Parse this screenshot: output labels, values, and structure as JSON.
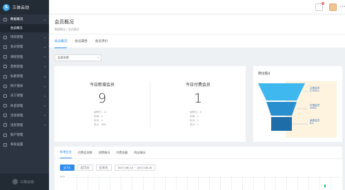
{
  "app": {
    "name": "三体云动",
    "logo_glyph": "S",
    "footer_brand": "三体云动"
  },
  "sidebar": {
    "items": [
      {
        "label": "数据概况",
        "active": true,
        "expanded": true
      },
      {
        "label": "场馆管理"
      },
      {
        "label": "会员管理"
      },
      {
        "label": "课程管理"
      },
      {
        "label": "营销管理"
      },
      {
        "label": "私教管理"
      },
      {
        "label": "统计报表"
      },
      {
        "label": "员工管理"
      },
      {
        "label": "商品管理"
      },
      {
        "label": "活动管理"
      },
      {
        "label": "消息管理"
      },
      {
        "label": "账户管理"
      },
      {
        "label": "系统设置"
      }
    ],
    "sub_items": [
      {
        "label": "会员概况"
      }
    ]
  },
  "topbar": {
    "notification_count": "1"
  },
  "header": {
    "title": "会员概况",
    "breadcrumb": "数据概况 / 会员概况"
  },
  "tabs": [
    {
      "label": "会员概况",
      "active": true
    },
    {
      "label": "会员属性"
    },
    {
      "label": "会员评价"
    }
  ],
  "filter": {
    "value": "全部场馆"
  },
  "stats": [
    {
      "title": "今日新增会员",
      "value": "9",
      "details": [
        "较昨日：12",
        "本周：0",
        "本月：0",
        "总计：469"
      ]
    },
    {
      "title": "今日付费会员",
      "value": "1",
      "details": [
        "较昨日：3",
        "本周：1",
        "本月：1",
        "总计：1"
      ]
    }
  ],
  "funnel": {
    "title": "转化漏斗",
    "stages": [
      {
        "label": "注册会员",
        "value": "2,304人",
        "color": "#3fb7ef"
      },
      {
        "label": "付费会员",
        "value": "348人",
        "color": "#2a8fcf"
      },
      {
        "label": "续费会员",
        "value": "8人",
        "color": "#1e6da8"
      }
    ]
  },
  "bottom": {
    "tabs": [
      {
        "label": "新增会员",
        "active": true
      },
      {
        "label": "付费会员数"
      },
      {
        "label": "续费情况"
      },
      {
        "label": "付费金额"
      },
      {
        "label": "到店情况"
      }
    ],
    "range_buttons": [
      {
        "label": "近7天",
        "active": true
      },
      {
        "label": "近15天"
      },
      {
        "label": "近30天"
      }
    ],
    "date_range": "2017-06-14 ~ 2017-06-20",
    "y_top_label": "600",
    "series_color": "#19be6b"
  }
}
